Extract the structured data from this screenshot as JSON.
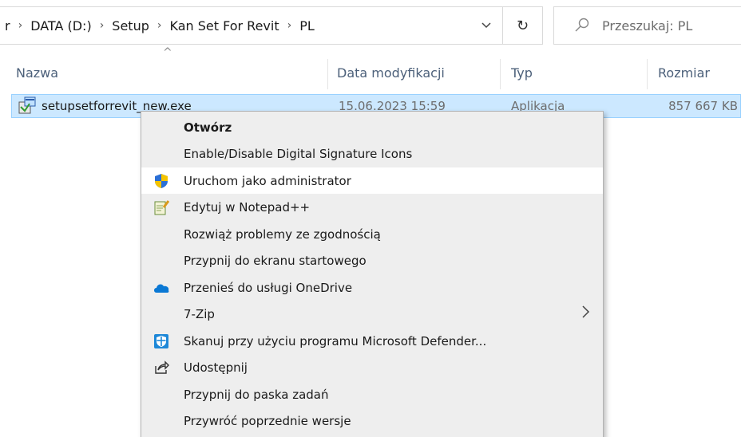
{
  "address": {
    "crumbs": [
      "r",
      "DATA (D:)",
      "Setup",
      "Kan Set For Revit",
      "PL"
    ],
    "separator": "›",
    "dropdown": "⌄",
    "refresh": "↻"
  },
  "search": {
    "placeholder": "Przeszukaj: PL"
  },
  "columns": {
    "name": "Nazwa",
    "date": "Data modyfikacji",
    "type": "Typ",
    "size": "Rozmiar",
    "sort_indicator": "^"
  },
  "file": {
    "name": "setupsetforrevit_new.exe",
    "date": "15.06.2023 15:59",
    "type": "Aplikacja",
    "size": "857 667 KB",
    "icon": "installer-icon"
  },
  "context_menu": {
    "items": [
      {
        "label": "Otwórz",
        "bold": true
      },
      {
        "label": "Enable/Disable Digital Signature Icons"
      },
      {
        "label": "Uruchom jako administrator",
        "icon": "uac-shield-icon",
        "highlighted": true
      },
      {
        "label": "Edytuj w Notepad++",
        "icon": "notepad-plus-plus-icon"
      },
      {
        "label": "Rozwiąż problemy ze zgodnością"
      },
      {
        "label": "Przypnij do ekranu startowego"
      },
      {
        "label": "Przenieś do usługi OneDrive",
        "icon": "onedrive-icon"
      },
      {
        "label": "7-Zip",
        "submenu": "›"
      },
      {
        "label": "Skanuj przy użyciu programu Microsoft Defender...",
        "icon": "defender-icon"
      },
      {
        "label": "Udostępnij",
        "icon": "share-icon"
      },
      {
        "label": "Przypnij do paska zadań"
      },
      {
        "label": "Przywróć poprzednie wersje"
      }
    ]
  },
  "colors": {
    "selection": "#cce8ff",
    "menu_bg": "#eeeeee",
    "header_text": "#4c607a"
  }
}
